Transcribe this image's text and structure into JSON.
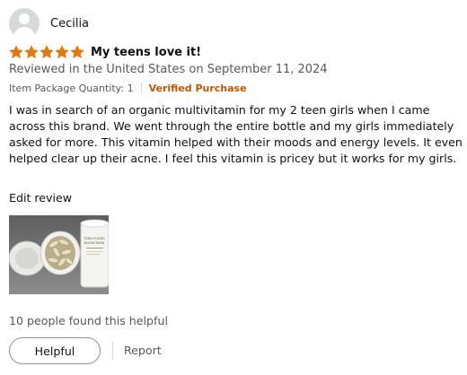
{
  "reviewer": {
    "name": "Cecilia",
    "avatar_icon": "default-profile-avatar"
  },
  "review": {
    "rating": 5,
    "rating_max": 5,
    "star_color": "#e47911",
    "title": "My teens love it!",
    "date_line": "Reviewed in the United States on September 11, 2024",
    "item_package": "Item Package Quantity: 1",
    "verified_label": "Verified Purchase",
    "verified_color": "#c45500",
    "body": "I was in search of an organic multivitamin for my 2 teen girls when I came across this brand. We went through the entire bottle and my girls immediately asked for more. This vitamin helped with their moods and energy levels. It even helped clear up their acne. I feel this vitamin is pricey but it works for my girls.",
    "edit_label": "Edit review"
  },
  "photo": {
    "bottle_label_line1": "TEEN FOODS",
    "bottle_label_line2": "MULTIVITAMIN"
  },
  "helpful": {
    "count_text": "10 people found this helpful",
    "button_label": "Helpful",
    "report_label": "Report"
  }
}
